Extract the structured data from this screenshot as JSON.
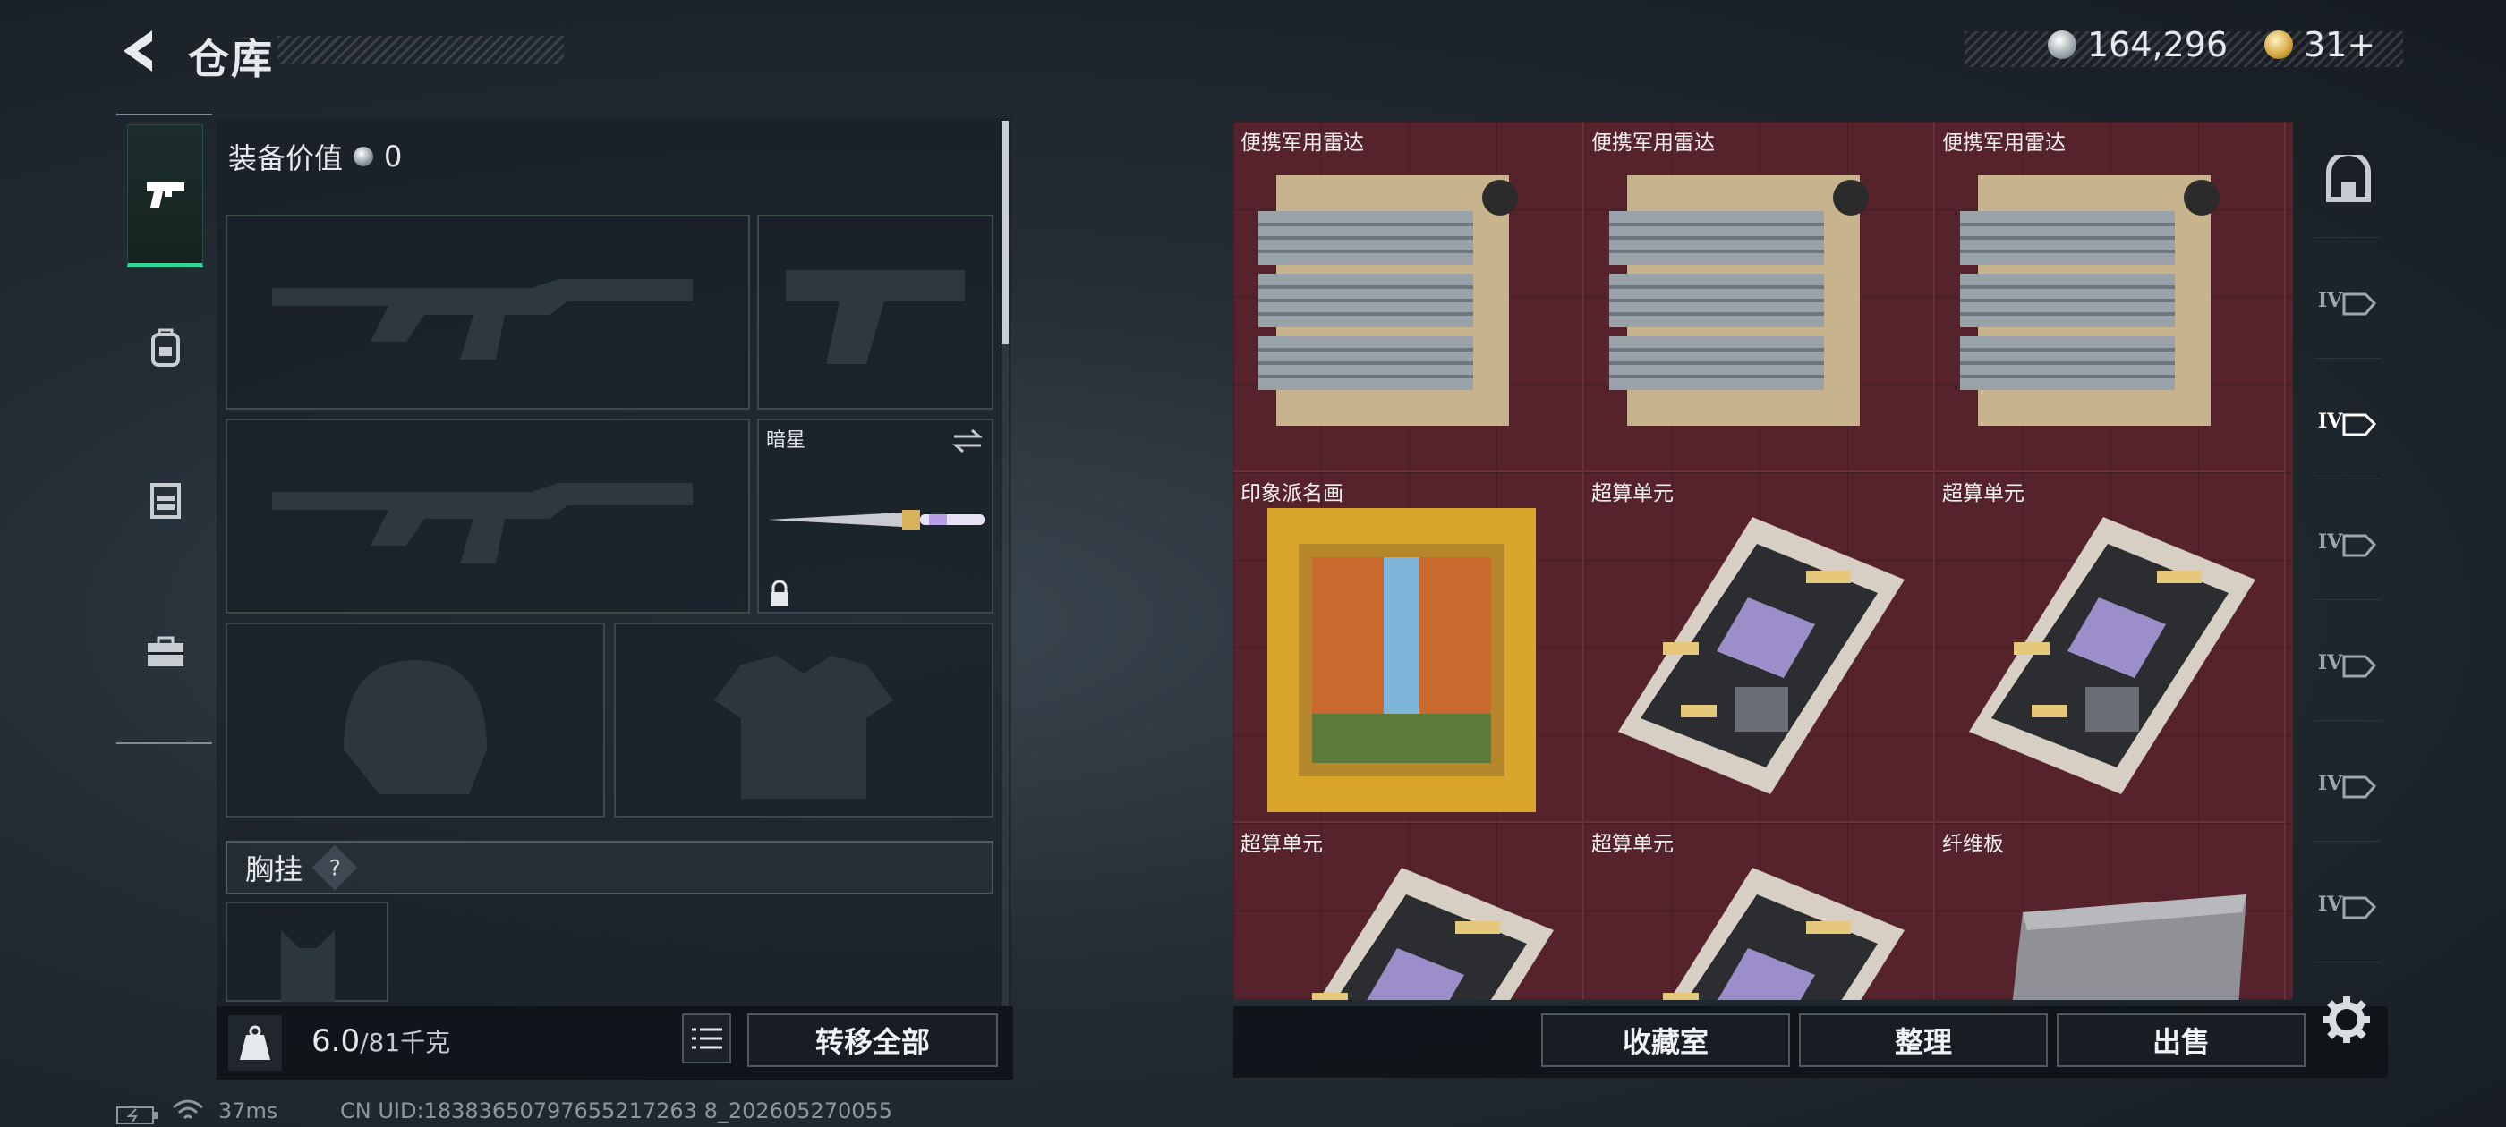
{
  "header": {
    "title": "仓库"
  },
  "currency": {
    "silver": "164,296",
    "gold": "31+"
  },
  "categories": [
    {
      "icon": "pistol-icon",
      "active": true
    },
    {
      "icon": "backpack-icon",
      "active": false
    },
    {
      "icon": "vest-icon",
      "active": false
    },
    {
      "icon": "toolbox-icon",
      "active": false
    }
  ],
  "loadout": {
    "value_label": "装备价值",
    "value": "0",
    "melee_name": "暗星",
    "chest_label": "胸挂",
    "chest_help": "?"
  },
  "capacity": {
    "current": "6.0",
    "max": "/81千克"
  },
  "buttons": {
    "transfer_all": "转移全部",
    "collection": "收藏室",
    "organize": "整理",
    "sell": "出售"
  },
  "storage": {
    "items": [
      {
        "name": "便携军用雷达",
        "icon": "radar-icon"
      },
      {
        "name": "便携军用雷达",
        "icon": "radar-icon"
      },
      {
        "name": "便携军用雷达",
        "icon": "radar-icon"
      },
      {
        "name": "印象派名画",
        "icon": "painting-icon"
      },
      {
        "name": "超算单元",
        "icon": "circuit-board-icon"
      },
      {
        "name": "超算单元",
        "icon": "circuit-board-icon"
      },
      {
        "name": "超算单元",
        "icon": "circuit-board-icon"
      },
      {
        "name": "超算单元",
        "icon": "circuit-board-icon"
      },
      {
        "name": "纤维板",
        "icon": "fiber-board-icon"
      }
    ]
  },
  "tiers": [
    {
      "label": "",
      "icon": "vault-icon"
    },
    {
      "label": "IV"
    },
    {
      "label": "IV",
      "active": true
    },
    {
      "label": "IV"
    },
    {
      "label": "IV"
    },
    {
      "label": "IV"
    },
    {
      "label": "IV"
    }
  ],
  "status": {
    "ping": "37ms",
    "uid": "CN UID:18383650797655217263 8_202605270055"
  }
}
